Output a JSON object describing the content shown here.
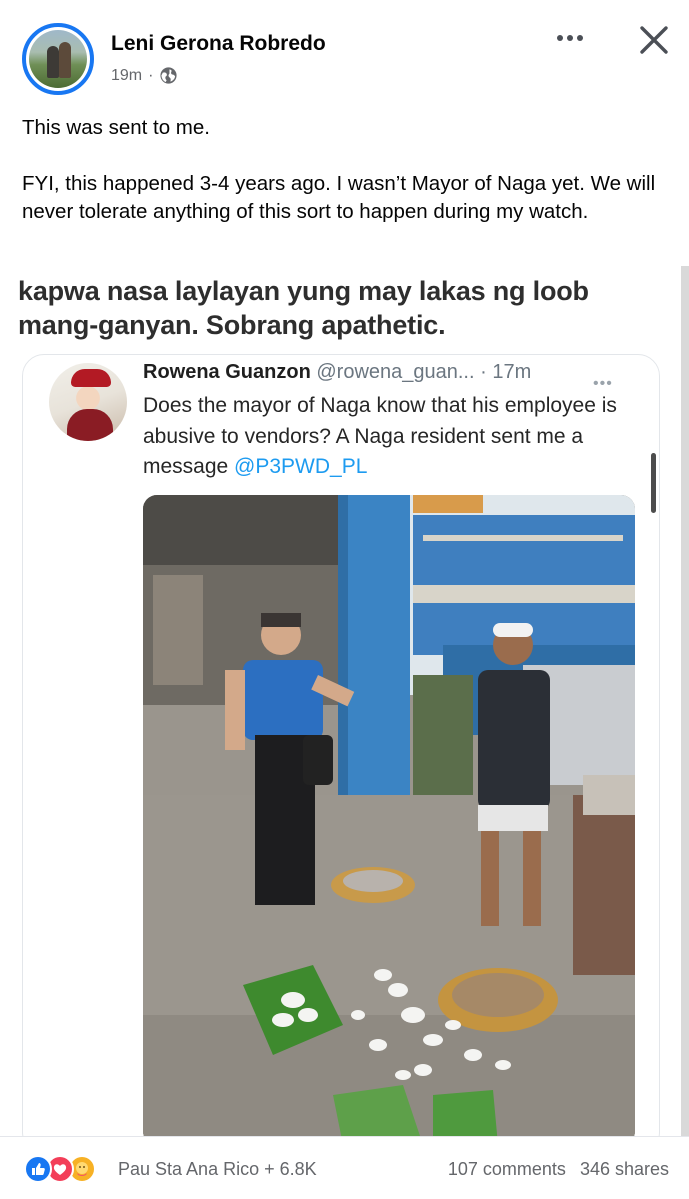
{
  "post": {
    "author": "Leni Gerona Robredo",
    "time": "19m",
    "separator": "·",
    "privacy_icon": "globe-icon",
    "caption": {
      "line1": "This was sent to me.",
      "line2": "FYI, this happened 3-4 years ago. I wasn’t Mayor of Naga yet. We will never tolerate anything of this sort to happen during my watch."
    }
  },
  "attachment": {
    "meme_text": "kapwa nasa laylayan yung may lakas ng loob mang-ganyan. Sobrang apathetic.",
    "tweet": {
      "name": "Rowena Guanzon",
      "handle": "@rowena_guan...",
      "time": "· 17m",
      "dots": "•••",
      "text": "Does the mayor of Naga know that his employee is abusive to vendors? A Naga resident sent me a message ",
      "mention": "@P3PWD_PL"
    }
  },
  "footer": {
    "reactors": "Pau Sta Ana Rico + 6.8K",
    "comments": "107 comments",
    "shares": "346 shares"
  },
  "colors": {
    "accent": "#1877f2",
    "love": "#f33e58",
    "care": "#f7b125",
    "mention": "#1d9bf0"
  }
}
